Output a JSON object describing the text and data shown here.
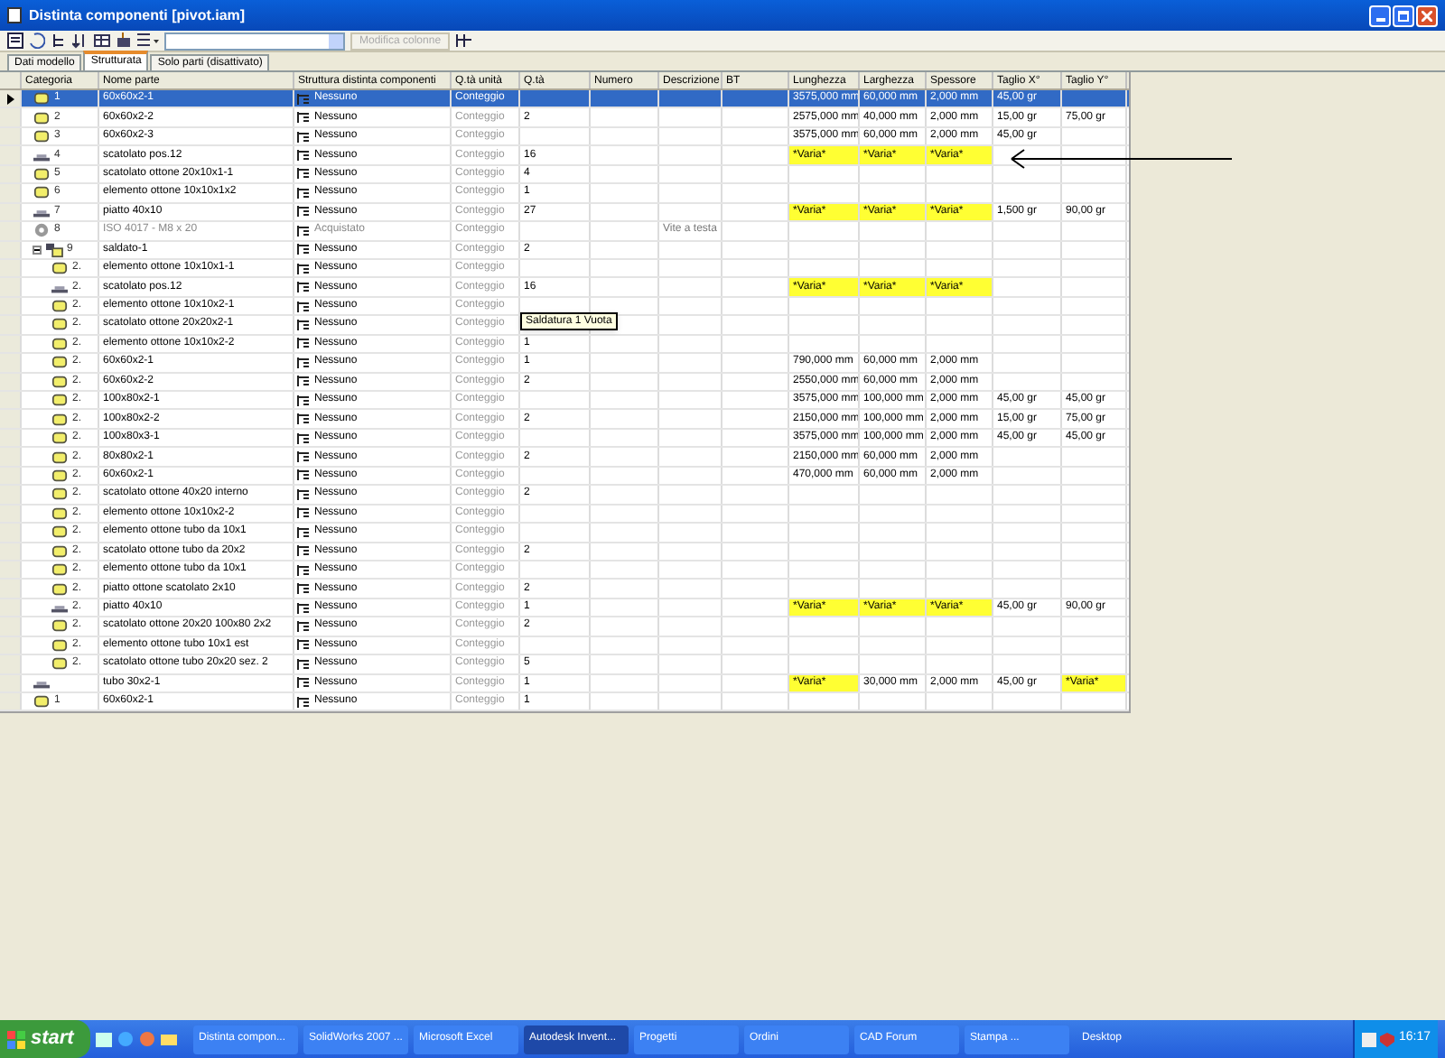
{
  "window": {
    "title": "Distinta componenti [pivot.iam]"
  },
  "toolbar": {
    "button_label": "Modifica colonne"
  },
  "tabs": [
    {
      "label": "Dati modello",
      "selected": false
    },
    {
      "label": "Strutturata",
      "selected": true
    },
    {
      "label": "Solo parti (disattivato)",
      "selected": false
    }
  ],
  "table": {
    "columns": [
      "Categoria",
      "Nome parte",
      "Struttura distinta componenti",
      "Q.tà unità",
      "Q.tà",
      "Numero",
      "Descrizione",
      "BT",
      "Lunghezza",
      "Larghezza",
      "Spessore",
      "Taglio X°",
      "Taglio Y°"
    ],
    "rows": [
      {
        "kind": "part",
        "num": "1",
        "name": "60x60x2-1",
        "structure": "Nessuno",
        "qty_unit": "Conteggio",
        "length": "3575,000 mm",
        "width": "60,000 mm",
        "thickness": "2,000 mm",
        "cut_x": "45,00 gr",
        "selected": true
      },
      {
        "kind": "part",
        "num": "2",
        "name": "60x60x2-2",
        "structure": "Nessuno",
        "qty_unit": "Conteggio",
        "qty": "2",
        "length": "2575,000 mm",
        "width": "40,000 mm",
        "thickness": "2,000 mm",
        "cut_x": "15,00 gr",
        "cut_y": "75,00 gr",
        "selected": false
      },
      {
        "kind": "part",
        "num": "3",
        "name": "60x60x2-3",
        "structure": "Nessuno",
        "qty_unit": "Conteggio",
        "length": "3575,000 mm",
        "width": "60,000 mm",
        "thickness": "2,000 mm",
        "cut_x": "45,00 gr",
        "selected": false
      },
      {
        "kind": "sheet",
        "num": "4",
        "name": "scatolato pos.12",
        "structure": "Nessuno",
        "qty_unit": "Conteggio",
        "qty": "16",
        "length": {
          "text": "*Varia*",
          "highlighted": true
        },
        "width": {
          "text": "*Varia*",
          "highlighted": true
        },
        "thickness": {
          "text": "*Varia*",
          "highlighted": true
        },
        "selected": false
      },
      {
        "kind": "part",
        "num": "5",
        "name": "scatolato ottone 20x10x1-1",
        "structure": "Nessuno",
        "qty_unit": "Conteggio",
        "qty": "4",
        "selected": false
      },
      {
        "kind": "part",
        "num": "6",
        "name": "elemento ottone 10x10x1x2",
        "structure": "Nessuno",
        "qty_unit": "Conteggio",
        "qty": "1",
        "selected": false
      },
      {
        "kind": "sheet",
        "num": "7",
        "name": "piatto 40x10",
        "structure": "Nessuno",
        "qty_unit": "Conteggio",
        "qty": "27",
        "length": {
          "text": "*Varia*",
          "highlighted": true
        },
        "width": {
          "text": "*Varia*",
          "highlighted": true
        },
        "thickness": {
          "text": "*Varia*",
          "highlighted": true
        },
        "cut_x": "1,500 gr",
        "cut_y": "90,00 gr",
        "selected": false
      },
      {
        "kind": "component",
        "num": "8",
        "name": "ISO 4017 - M8 x 20",
        "structure": "Acquistato",
        "qty_unit": "Conteggio",
        "description": "Vite a testa",
        "selected": false
      },
      {
        "kind": "assembly",
        "num": "9",
        "name": "saldato-1",
        "structure": "Nessuno",
        "qty_unit": "Conteggio",
        "qty": "2",
        "selected": false,
        "expanded": true,
        "children": [
          {
            "kind": "part",
            "num": "2.",
            "name": "elemento ottone 10x10x1-1",
            "structure": "Nessuno",
            "qty_unit": "Conteggio",
            "selected": false
          },
          {
            "kind": "sheet",
            "num": "2.",
            "name": "scatolato pos.12",
            "structure": "Nessuno",
            "qty_unit": "Conteggio",
            "qty": "16",
            "length": {
              "text": "*Varia*",
              "highlighted": true
            },
            "width": {
              "text": "*Varia*",
              "highlighted": true
            },
            "thickness": {
              "text": "*Varia*",
              "highlighted": true
            },
            "selected": false
          },
          {
            "kind": "part",
            "num": "2.",
            "name": "elemento ottone 10x10x2-1",
            "structure": "Nessuno",
            "qty_unit": "Conteggio",
            "selected": false
          },
          {
            "kind": "part",
            "num": "2.",
            "name": "scatolato ottone 20x20x2-1",
            "structure": "Nessuno",
            "qty_unit": "Conteggio",
            "selected": false
          },
          {
            "kind": "part",
            "num": "2.",
            "name": "elemento ottone 10x10x2-2",
            "structure": "Nessuno",
            "qty_unit": "Conteggio",
            "qty": "1",
            "selected": false
          },
          {
            "kind": "part",
            "num": "2.",
            "name": "60x60x2-1",
            "structure": "Nessuno",
            "qty_unit": "Conteggio",
            "qty": "1",
            "length": "790,000 mm",
            "width": "60,000 mm",
            "thickness": "2,000 mm",
            "selected": false
          },
          {
            "kind": "part",
            "num": "2.",
            "name": "60x60x2-2",
            "structure": "Nessuno",
            "qty_unit": "Conteggio",
            "qty": "2",
            "length": "2550,000 mm",
            "width": "60,000 mm",
            "thickness": "2,000 mm",
            "selected": false
          },
          {
            "kind": "part",
            "num": "2.",
            "name": "100x80x2-1",
            "structure": "Nessuno",
            "qty_unit": "Conteggio",
            "length": "3575,000 mm",
            "width": "100,000 mm",
            "thickness": "2,000 mm",
            "cut_x": "45,00 gr",
            "cut_y": "45,00 gr",
            "selected": false
          },
          {
            "kind": "part",
            "num": "2.",
            "name": "100x80x2-2",
            "structure": "Nessuno",
            "qty_unit": "Conteggio",
            "qty": "2",
            "length": "2150,000 mm",
            "width": "100,000 mm",
            "thickness": "2,000 mm",
            "cut_x": "15,00 gr",
            "cut_y": "75,00 gr",
            "selected": false
          },
          {
            "kind": "part",
            "num": "2.",
            "name": "100x80x3-1",
            "structure": "Nessuno",
            "qty_unit": "Conteggio",
            "length": "3575,000 mm",
            "width": "100,000 mm",
            "thickness": "2,000 mm",
            "cut_x": "45,00 gr",
            "cut_y": "45,00 gr",
            "selected": false
          },
          {
            "kind": "part",
            "num": "2.",
            "name": "80x80x2-1",
            "structure": "Nessuno",
            "qty_unit": "Conteggio",
            "qty": "2",
            "length": "2150,000 mm",
            "width": "60,000 mm",
            "thickness": "2,000 mm",
            "selected": false
          },
          {
            "kind": "part",
            "num": "2.",
            "name": "60x60x2-1",
            "structure": "Nessuno",
            "qty_unit": "Conteggio",
            "length": "470,000 mm",
            "width": "60,000 mm",
            "thickness": "2,000 mm",
            "selected": false
          },
          {
            "kind": "part",
            "num": "2.",
            "name": "scatolato ottone 40x20 interno",
            "structure": "Nessuno",
            "qty_unit": "Conteggio",
            "qty": "2",
            "selected": false
          },
          {
            "kind": "part",
            "num": "2.",
            "name": "elemento ottone 10x10x2-2",
            "structure": "Nessuno",
            "qty_unit": "Conteggio",
            "selected": false
          },
          {
            "kind": "part",
            "num": "2.",
            "name": "elemento ottone tubo da 10x1",
            "structure": "Nessuno",
            "qty_unit": "Conteggio",
            "selected": false
          },
          {
            "kind": "part",
            "num": "2.",
            "name": "scatolato ottone tubo da 20x2",
            "structure": "Nessuno",
            "qty_unit": "Conteggio",
            "qty": "2",
            "selected": false
          },
          {
            "kind": "part",
            "num": "2.",
            "name": "elemento ottone tubo da 10x1",
            "structure": "Nessuno",
            "qty_unit": "Conteggio",
            "selected": false
          },
          {
            "kind": "part",
            "num": "2.",
            "name": "piatto ottone scatolato 2x10",
            "structure": "Nessuno",
            "qty_unit": "Conteggio",
            "qty": "2",
            "selected": false
          },
          {
            "kind": "sheet",
            "num": "2.",
            "name": "piatto 40x10",
            "structure": "Nessuno",
            "qty_unit": "Conteggio",
            "qty": "1",
            "length": {
              "text": "*Varia*",
              "highlighted": true
            },
            "width": {
              "text": "*Varia*",
              "highlighted": true
            },
            "thickness": {
              "text": "*Varia*",
              "highlighted": true
            },
            "cut_x": "45,00 gr",
            "cut_y": "90,00 gr",
            "selected": false
          },
          {
            "kind": "part",
            "num": "2.",
            "name": "scatolato ottone 20x20 100x80 2x2",
            "structure": "Nessuno",
            "qty_unit": "Conteggio",
            "qty": "2",
            "selected": false
          },
          {
            "kind": "part",
            "num": "2.",
            "name": "elemento ottone tubo 10x1 est",
            "structure": "Nessuno",
            "qty_unit": "Conteggio",
            "selected": false
          },
          {
            "kind": "part",
            "num": "2.",
            "name": "scatolato ottone tubo 20x20 sez. 2",
            "structure": "Nessuno",
            "qty_unit": "Conteggio",
            "qty": "5",
            "selected": false
          }
        ]
      },
      {
        "kind": "sheet",
        "name": "tubo 30x2-1",
        "structure": "Nessuno",
        "qty_unit": "Conteggio",
        "qty": "1",
        "length": {
          "text": "*Varia*",
          "highlighted": true
        },
        "width": "30,000 mm",
        "thickness": "2,000 mm",
        "cut_x": "45,00 gr",
        "cut_y": {
          "text": "*Varia*",
          "highlighted": true
        },
        "selected": false
      },
      {
        "kind": "part",
        "num": "1",
        "name": "60x60x2-1",
        "structure": "Nessuno",
        "qty_unit": "Conteggio",
        "qty": "1",
        "selected": false
      }
    ]
  },
  "tooltip": "Saldatura 1 Vuota",
  "taskbar": {
    "start": "start",
    "tasks": [
      {
        "label": "Distinta compon...",
        "selected": false
      },
      {
        "label": "SolidWorks 2007 ...",
        "selected": false
      },
      {
        "label": "Microsoft Excel",
        "selected": false
      },
      {
        "label": "Autodesk Invent...",
        "selected": true
      },
      {
        "label": "Progetti",
        "selected": false
      },
      {
        "label": "Ordini",
        "selected": false
      },
      {
        "label": "CAD Forum",
        "selected": false
      },
      {
        "label": "Stampa ...",
        "selected": false
      }
    ],
    "desktop": "Desktop",
    "clock": "16:17"
  }
}
